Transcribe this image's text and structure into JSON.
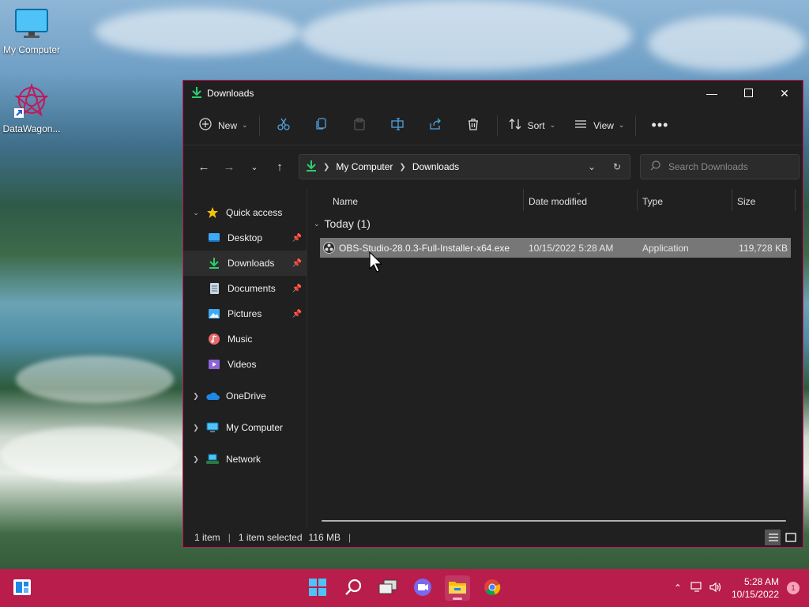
{
  "desktop": {
    "icons": [
      {
        "label": "My Computer",
        "icon": "monitor-icon"
      },
      {
        "label": "DataWagon...",
        "icon": "datawagon-shortcut-icon"
      }
    ]
  },
  "window": {
    "title": "Downloads",
    "toolbar": {
      "new_label": "New",
      "sort_label": "Sort",
      "view_label": "View"
    },
    "address": {
      "crumbs": [
        "My Computer",
        "Downloads"
      ]
    },
    "search": {
      "placeholder": "Search Downloads"
    },
    "sidebar": {
      "quick_access": "Quick access",
      "items": [
        {
          "label": "Desktop",
          "icon": "desktop-folder-icon",
          "pinned": true
        },
        {
          "label": "Downloads",
          "icon": "download-icon",
          "pinned": true,
          "selected": true
        },
        {
          "label": "Documents",
          "icon": "documents-icon",
          "pinned": true
        },
        {
          "label": "Pictures",
          "icon": "pictures-icon",
          "pinned": true
        },
        {
          "label": "Music",
          "icon": "music-icon",
          "pinned": false
        },
        {
          "label": "Videos",
          "icon": "videos-icon",
          "pinned": false
        }
      ],
      "roots": [
        {
          "label": "OneDrive",
          "icon": "cloud-icon"
        },
        {
          "label": "My Computer",
          "icon": "monitor-icon"
        },
        {
          "label": "Network",
          "icon": "network-icon"
        }
      ]
    },
    "columns": {
      "name": "Name",
      "date": "Date modified",
      "type": "Type",
      "size": "Size"
    },
    "group_label": "Today (1)",
    "files": [
      {
        "name": "OBS-Studio-28.0.3-Full-Installer-x64.exe",
        "date": "10/15/2022 5:28 AM",
        "type": "Application",
        "size": "119,728 KB"
      }
    ],
    "status": {
      "count": "1 item",
      "selected": "1 item selected",
      "size": "116 MB"
    }
  },
  "taskbar": {
    "clock_time": "5:28 AM",
    "clock_date": "10/15/2022",
    "notification_count": "1"
  },
  "colors": {
    "taskbar": "#b81d4c",
    "window_border": "#c2185b",
    "window_bg": "#202020",
    "accent_green": "#2ecc71"
  }
}
